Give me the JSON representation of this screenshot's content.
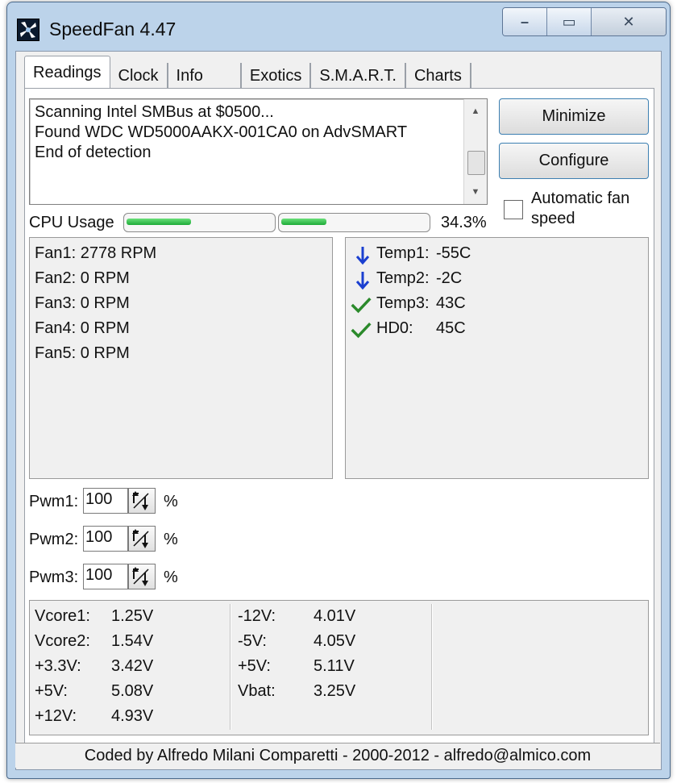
{
  "window": {
    "title": "SpeedFan 4.47",
    "minimize_glyph": "–",
    "maximize_glyph": "▭",
    "close_glyph": "✕"
  },
  "tabs": [
    {
      "label": "Readings",
      "active": true
    },
    {
      "label": "Clock"
    },
    {
      "label": "Info"
    },
    {
      "label": "Exotics"
    },
    {
      "label": "S.M.A.R.T."
    },
    {
      "label": "Charts"
    }
  ],
  "log": {
    "lines": [
      "Scanning Intel SMBus at $0500...",
      "Found WDC WD5000AAKX-001CA0 on AdvSMART",
      "End of detection"
    ],
    "scroll_up_glyph": "▲",
    "scroll_down_glyph": "▼"
  },
  "buttons": {
    "minimize": "Minimize",
    "configure": "Configure"
  },
  "auto_fan": {
    "line1": "Automatic fan",
    "line2": "speed",
    "checked": false
  },
  "cpu": {
    "label": "CPU Usage",
    "percent_text": "34.3%",
    "core_fill": [
      0.44,
      0.31
    ]
  },
  "fans": [
    "Fan1: 2778 RPM",
    "Fan2: 0 RPM",
    "Fan3: 0 RPM",
    "Fan4: 0 RPM",
    "Fan5: 0 RPM"
  ],
  "temps": [
    {
      "label": "Temp1:",
      "value": "-55C",
      "status": "arrow-down-icon",
      "color": "#1a3fd0"
    },
    {
      "label": "Temp2:",
      "value": "-2C",
      "status": "arrow-down-icon",
      "color": "#1a3fd0"
    },
    {
      "label": "Temp3:",
      "value": "43C",
      "status": "checkmark-icon",
      "color": "#2b8a2b"
    },
    {
      "label": "HD0:",
      "value": "45C",
      "status": "checkmark-icon",
      "color": "#2b8a2b"
    }
  ],
  "pwm": [
    {
      "label": "Pwm1:",
      "value": "100",
      "unit": "%"
    },
    {
      "label": "Pwm2:",
      "value": "100",
      "unit": "%"
    },
    {
      "label": "Pwm3:",
      "value": "100",
      "unit": "%"
    }
  ],
  "voltages_left": [
    {
      "name": "Vcore1:",
      "value": "1.25V"
    },
    {
      "name": "Vcore2:",
      "value": "1.54V"
    },
    {
      "name": "+3.3V:",
      "value": "3.42V"
    },
    {
      "name": "+5V:",
      "value": "5.08V"
    },
    {
      "name": "+12V:",
      "value": "4.93V"
    }
  ],
  "voltages_right": [
    {
      "name": "-12V:",
      "value": "4.01V"
    },
    {
      "name": "-5V:",
      "value": "4.05V"
    },
    {
      "name": "+5V:",
      "value": "5.11V"
    },
    {
      "name": "Vbat:",
      "value": "3.25V"
    }
  ],
  "status": "Coded by Alfredo Milani Comparetti - 2000-2012 - alfredo@almico.com"
}
